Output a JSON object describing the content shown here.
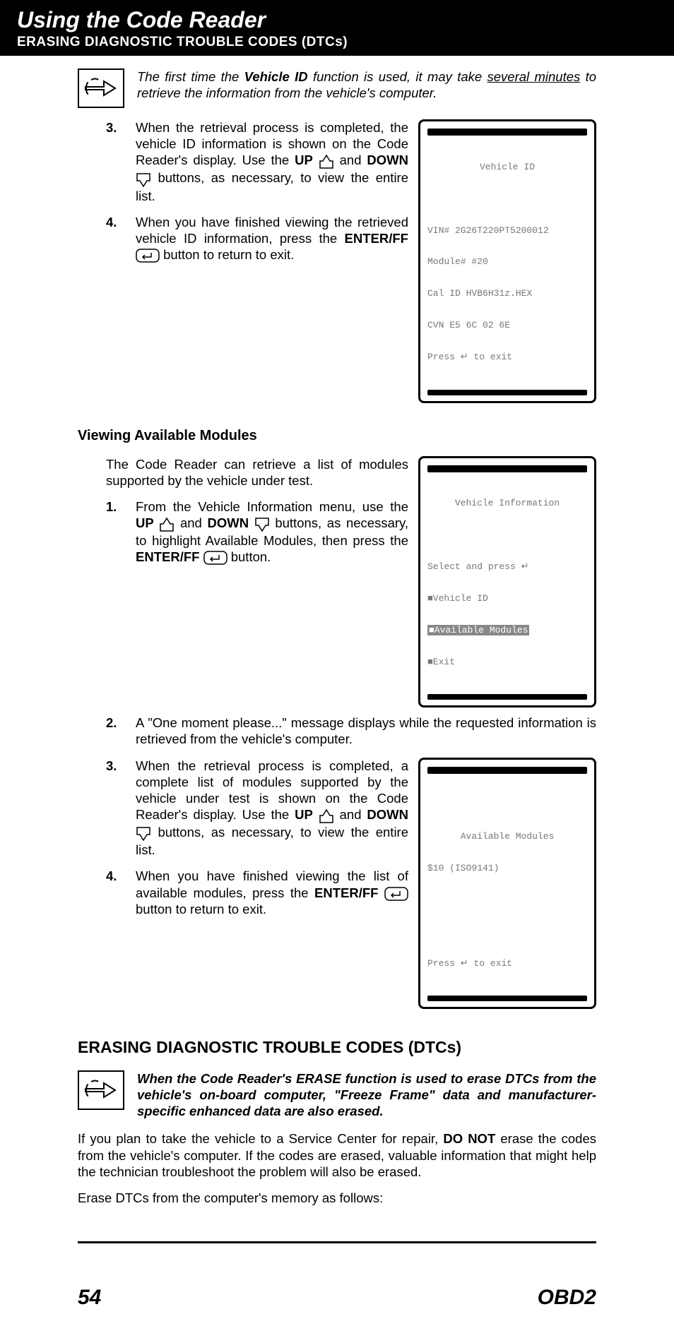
{
  "header": {
    "title": "Using the Code Reader",
    "subtitle": "ERASING DIAGNOSTIC TROUBLE CODES (DTCs)"
  },
  "note1": {
    "pre": "The first time the ",
    "bold": "Vehicle ID",
    "mid": " function is used, it may take ",
    "ul": "several minutes",
    "post": " to retrieve the information from the vehicle's computer."
  },
  "steps_a": {
    "s3": {
      "num": "3.",
      "t1": "When the retrieval process is completed, the vehicle ID information is shown on the Code Reader's display. Use the ",
      "up": "UP",
      "t2": " and ",
      "down": "DOWN",
      "t3": " buttons, as necessary, to view the entire list."
    },
    "s4": {
      "num": "4.",
      "t1": "When you have finished viewing the retrieved vehicle ID information, press the ",
      "enter": "ENTER/FF",
      "t2": " button to return to exit."
    }
  },
  "device1": {
    "title": "Vehicle ID",
    "l1": "VIN# 2G26T220PT5200012",
    "l2": "Module# #20",
    "l3": "Cal ID HVB6H31z.HEX",
    "l4": "CVN E5 6C 02 6E",
    "l5": "Press ↵ to exit"
  },
  "sec2": {
    "head": "Viewing Available Modules",
    "intro": "The Code Reader can retrieve a list of modules supported by the vehicle under test.",
    "s1": {
      "num": "1.",
      "t1": "From the Vehicle Information menu, use the ",
      "up": "UP",
      "t2": " and ",
      "down": "DOWN",
      "t3": " buttons, as necessary, to highlight Available Modules, then press the ",
      "enter": "ENTER/FF",
      "t4": " button."
    },
    "s2": {
      "num": "2.",
      "text": "A \"One moment please...\" message displays while the requested information is retrieved from the vehicle's computer."
    },
    "s3": {
      "num": "3.",
      "t1": "When the retrieval process is completed, a complete list of modules supported by the vehicle under test is shown on the Code Reader's display. Use the ",
      "up": "UP",
      "t2": " and ",
      "down": "DOWN",
      "t3": " buttons, as necessary, to view the entire list."
    },
    "s4": {
      "num": "4.",
      "t1": "When you have finished viewing the list of available modules, press the ",
      "enter": "ENTER/FF",
      "t2": " button to return to exit."
    }
  },
  "device2": {
    "title": "Vehicle Information",
    "l1": "Select and press ↵",
    "l2": "■Vehicle ID",
    "l3": "■Available Modules",
    "l4": "■Exit"
  },
  "device3": {
    "title": "Available Modules",
    "l1": "$10 (ISO9141)",
    "l2": "Press ↵ to exit"
  },
  "sec3": {
    "head": "ERASING DIAGNOSTIC TROUBLE CODES (DTCs)",
    "note": "When the Code Reader's ERASE function is used to erase DTCs from the vehicle's on-board computer, \"Freeze Frame\" data and manufacturer-specific enhanced data are also erased.",
    "p1a": "If you plan to take the vehicle to a Service Center for repair, ",
    "p1b": "DO NOT",
    "p1c": " erase the codes from the vehicle's computer. If the codes are erased, valuable information that might help the technician troubleshoot the problem will also be erased.",
    "p2": "Erase DTCs from the computer's memory as follows:"
  },
  "footer": {
    "left": "54",
    "right": "OBD2"
  }
}
